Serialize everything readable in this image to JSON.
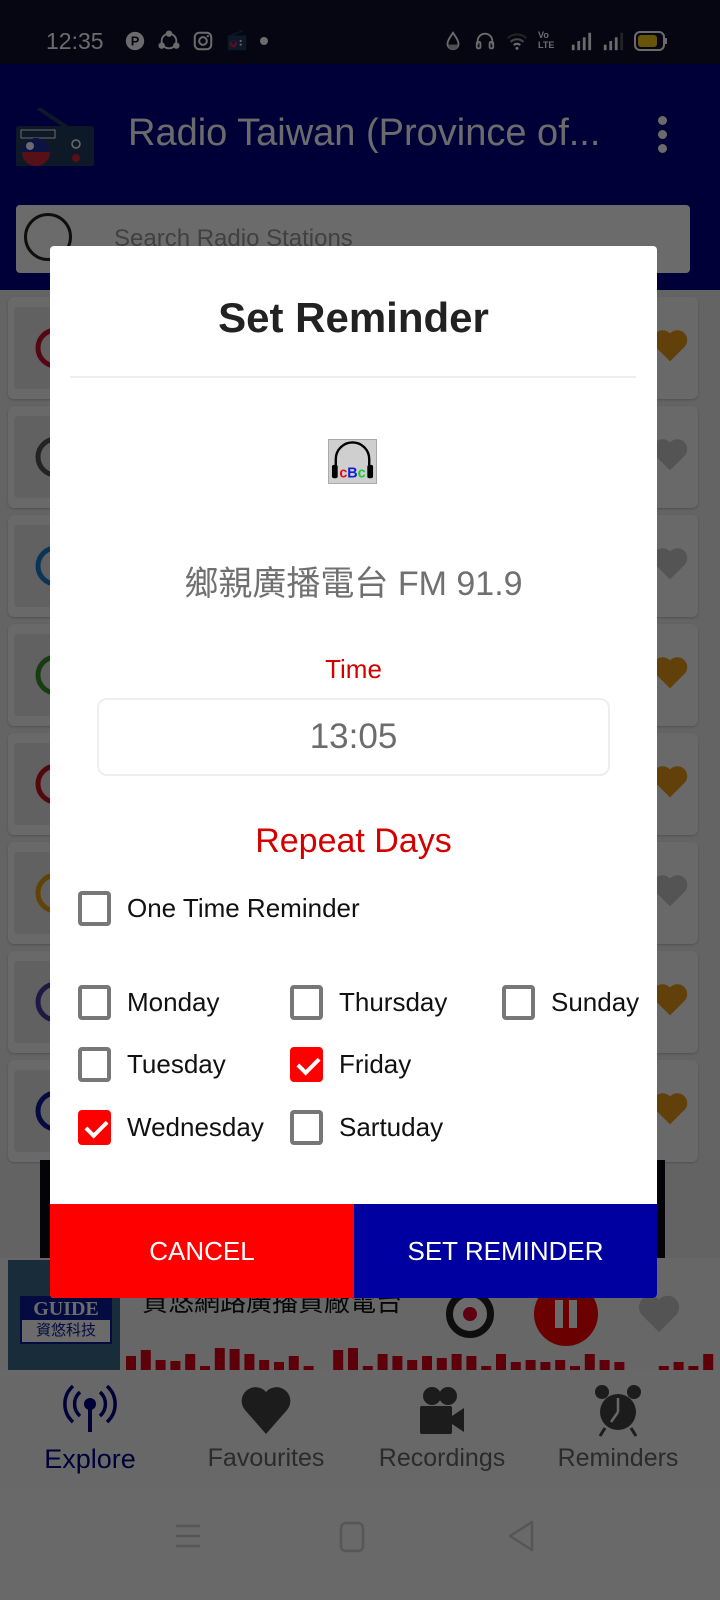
{
  "status_bar": {
    "time": "12:35",
    "left_icons": [
      "pinterest-icon",
      "share-icon",
      "instagram-icon",
      "radio-app-icon",
      "dot-icon"
    ],
    "right_icons": [
      "water-drop-icon",
      "headset-icon",
      "wifi-icon",
      "volte-icon",
      "signal-icon",
      "signal-icon",
      "battery-icon"
    ],
    "volte_label": "Vo LTE"
  },
  "app_bar": {
    "title": "Radio Taiwan (Province of...",
    "search_placeholder": "Search Radio Stations"
  },
  "station_list": {
    "rows": [
      {
        "logo": "red-circle-logo",
        "favourite": true
      },
      {
        "logo": "plane-logo",
        "favourite": false
      },
      {
        "logo": "p-logo",
        "favourite": false
      },
      {
        "logo": "93-logo",
        "favourite": true
      },
      {
        "logo": "headphone-logo",
        "favourite": true
      },
      {
        "logo": "fm-logo",
        "favourite": false
      },
      {
        "logo": "globe-logo",
        "favourite": true
      },
      {
        "logo": "guide-logo",
        "favourite": true
      }
    ]
  },
  "mini_player": {
    "logo_top": "GUIDE",
    "logo_bottom": "資悠科技",
    "title": "資悠網路廣播貿廠電台",
    "playing": true
  },
  "bottom_nav": {
    "items": [
      {
        "label": "Explore",
        "icon": "broadcast-icon",
        "active": true
      },
      {
        "label": "Favourites",
        "icon": "heart-icon",
        "active": false
      },
      {
        "label": "Recordings",
        "icon": "video-camera-icon",
        "active": false
      },
      {
        "label": "Reminders",
        "icon": "alarm-clock-icon",
        "active": false
      }
    ]
  },
  "dialog": {
    "title": "Set Reminder",
    "station_logo_text": "cBc",
    "station_name": "鄉親廣播電台 FM 91.9",
    "time_label": "Time",
    "time_value": "13:05",
    "repeat_label": "Repeat Days",
    "one_time": {
      "label": "One Time Reminder",
      "checked": false
    },
    "days": [
      {
        "label": "Monday",
        "checked": false
      },
      {
        "label": "Tuesday",
        "checked": false
      },
      {
        "label": "Wednesday",
        "checked": true
      },
      {
        "label": "Thursday",
        "checked": false
      },
      {
        "label": "Friday",
        "checked": true
      },
      {
        "label": "Sartuday",
        "checked": false
      },
      {
        "label": "Sunday",
        "checked": false
      }
    ],
    "cancel_label": "CANCEL",
    "set_label": "SET REMINDER"
  },
  "colors": {
    "app_bar": "#020288",
    "accent_red": "#ff0000",
    "label_red": "#d40000",
    "set_button": "#0000a0",
    "favourite_heart": "#e89a1a",
    "inactive_heart": "#c8c8c8"
  }
}
